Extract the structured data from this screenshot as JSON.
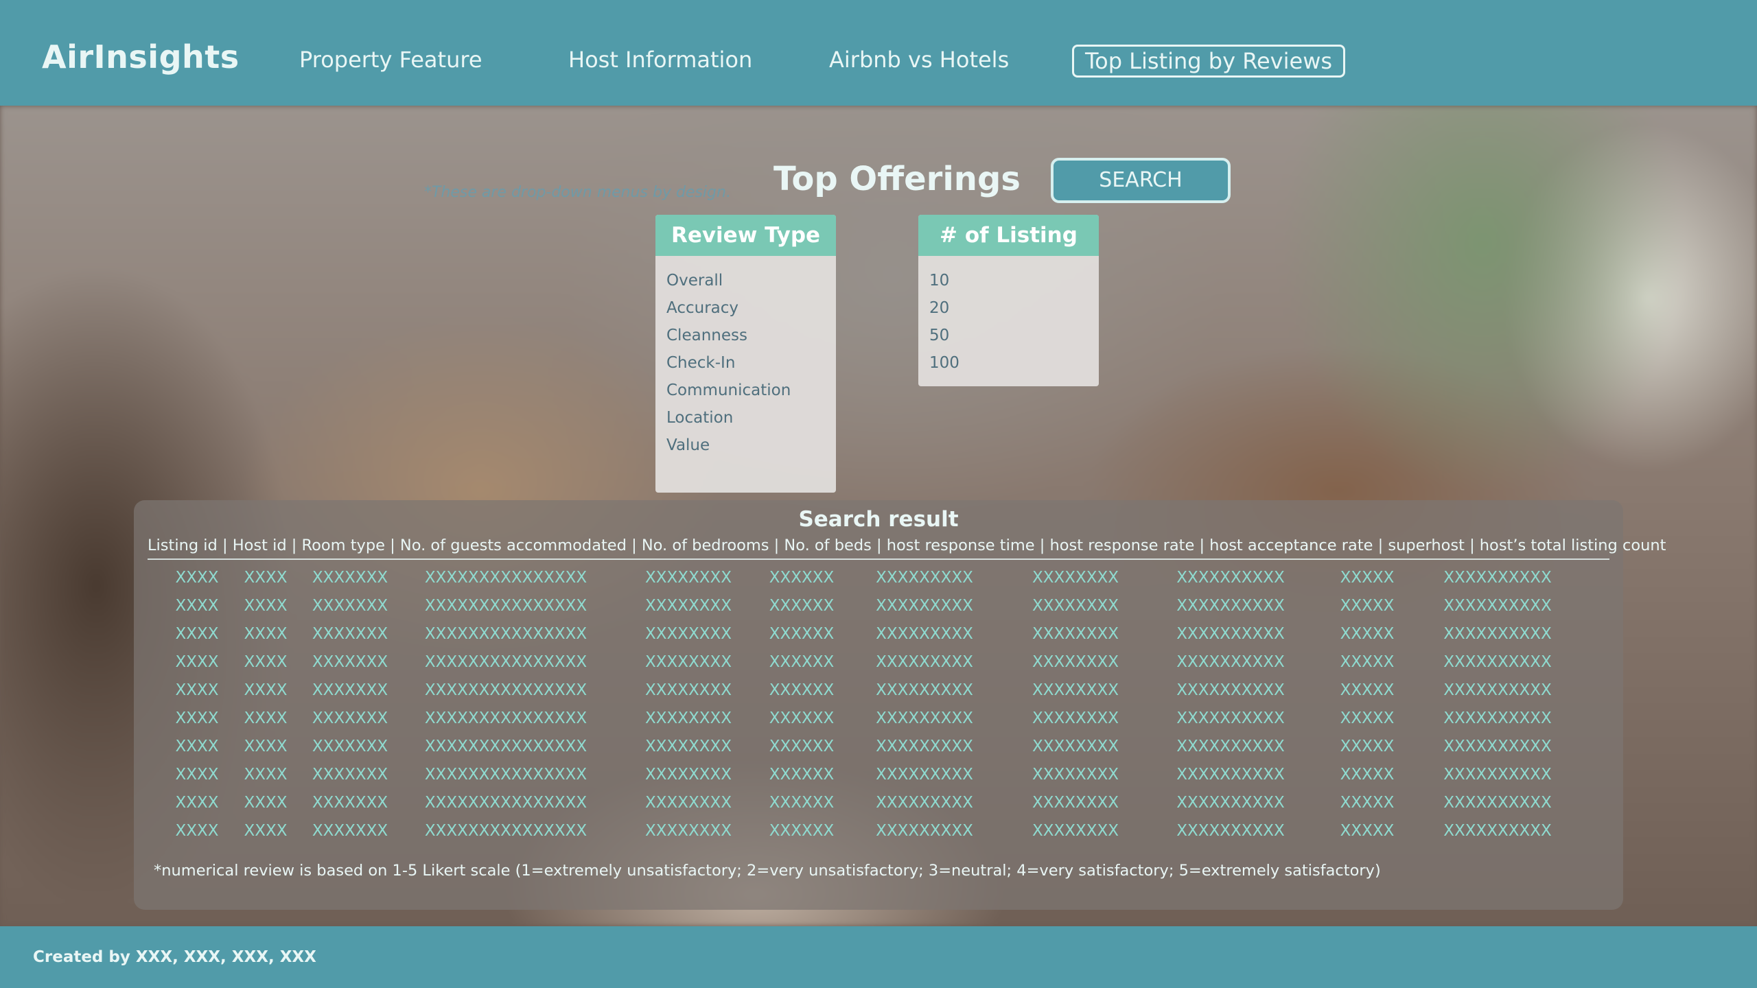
{
  "app": {
    "logo": "AirInsights"
  },
  "nav": {
    "items": [
      {
        "label": "Property Feature"
      },
      {
        "label": "Host Information"
      },
      {
        "label": "Airbnb vs Hotels"
      },
      {
        "label": "Top Listing by Reviews",
        "active": true
      }
    ]
  },
  "main": {
    "title": "Top Offerings",
    "note": "*These are drop-down menus by design.",
    "search_label": "SEARCH"
  },
  "review_type": {
    "header": "Review Type",
    "options": [
      "Overall",
      "Accuracy",
      "Cleanness",
      "Check-In",
      "Communication",
      "Location",
      "Value"
    ]
  },
  "listing_count": {
    "header": "# of Listing",
    "options": [
      "10",
      "20",
      "50",
      "100"
    ]
  },
  "results": {
    "title": "Search result",
    "header_line": "Listing id | Host id | Room type | No. of guests accommodated | No. of bedrooms | No. of beds | host response time | host response rate | host acceptance rate  | superhost | host’s total listing count",
    "rows": [
      [
        "XXXX",
        "XXXX",
        "XXXXXXX",
        "XXXXXXXXXXXXXXX",
        "XXXXXXXX",
        "XXXXXX",
        "XXXXXXXXX",
        "XXXXXXXX",
        "XXXXXXXXXX",
        "XXXXX",
        "XXXXXXXXXX"
      ],
      [
        "XXXX",
        "XXXX",
        "XXXXXXX",
        "XXXXXXXXXXXXXXX",
        "XXXXXXXX",
        "XXXXXX",
        "XXXXXXXXX",
        "XXXXXXXX",
        "XXXXXXXXXX",
        "XXXXX",
        "XXXXXXXXXX"
      ],
      [
        "XXXX",
        "XXXX",
        "XXXXXXX",
        "XXXXXXXXXXXXXXX",
        "XXXXXXXX",
        "XXXXXX",
        "XXXXXXXXX",
        "XXXXXXXX",
        "XXXXXXXXXX",
        "XXXXX",
        "XXXXXXXXXX"
      ],
      [
        "XXXX",
        "XXXX",
        "XXXXXXX",
        "XXXXXXXXXXXXXXX",
        "XXXXXXXX",
        "XXXXXX",
        "XXXXXXXXX",
        "XXXXXXXX",
        "XXXXXXXXXX",
        "XXXXX",
        "XXXXXXXXXX"
      ],
      [
        "XXXX",
        "XXXX",
        "XXXXXXX",
        "XXXXXXXXXXXXXXX",
        "XXXXXXXX",
        "XXXXXX",
        "XXXXXXXXX",
        "XXXXXXXX",
        "XXXXXXXXXX",
        "XXXXX",
        "XXXXXXXXXX"
      ],
      [
        "XXXX",
        "XXXX",
        "XXXXXXX",
        "XXXXXXXXXXXXXXX",
        "XXXXXXXX",
        "XXXXXX",
        "XXXXXXXXX",
        "XXXXXXXX",
        "XXXXXXXXXX",
        "XXXXX",
        "XXXXXXXXXX"
      ],
      [
        "XXXX",
        "XXXX",
        "XXXXXXX",
        "XXXXXXXXXXXXXXX",
        "XXXXXXXX",
        "XXXXXX",
        "XXXXXXXXX",
        "XXXXXXXX",
        "XXXXXXXXXX",
        "XXXXX",
        "XXXXXXXXXX"
      ],
      [
        "XXXX",
        "XXXX",
        "XXXXXXX",
        "XXXXXXXXXXXXXXX",
        "XXXXXXXX",
        "XXXXXX",
        "XXXXXXXXX",
        "XXXXXXXX",
        "XXXXXXXXXX",
        "XXXXX",
        "XXXXXXXXXX"
      ],
      [
        "XXXX",
        "XXXX",
        "XXXXXXX",
        "XXXXXXXXXXXXXXX",
        "XXXXXXXX",
        "XXXXXX",
        "XXXXXXXXX",
        "XXXXXXXX",
        "XXXXXXXXXX",
        "XXXXX",
        "XXXXXXXXXX"
      ],
      [
        "XXXX",
        "XXXX",
        "XXXXXXX",
        "XXXXXXXXXXXXXXX",
        "XXXXXXXX",
        "XXXXXX",
        "XXXXXXXXX",
        "XXXXXXXX",
        "XXXXXXXXXX",
        "XXXXX",
        "XXXXXXXXXX"
      ]
    ],
    "footnote": "*numerical review is based on 1-5 Likert scale (1=extremely unsatisfactory; 2=very unsatisfactory; 3=neutral; 4=very satisfactory; 5=extremely satisfactory)"
  },
  "footer": {
    "credit": "Created by XXX, XXX, XXX, XXX"
  },
  "colors": {
    "topbar": "#519ba9",
    "dropdown_header": "#7ac8b4",
    "cell_text": "#8fdbd0",
    "note_text": "#6f9aa7"
  }
}
